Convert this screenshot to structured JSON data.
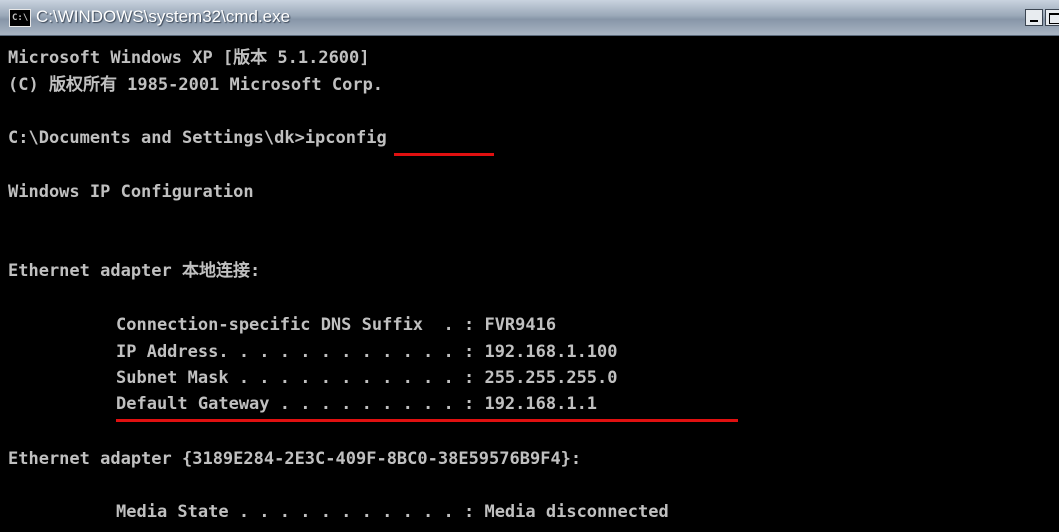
{
  "window": {
    "title": "C:\\WINDOWS\\system32\\cmd.exe",
    "icon_text": "C:\\"
  },
  "console": {
    "lines": {
      "version": "Microsoft Windows XP [版本 5.1.2600]",
      "copyright": "(C) 版权所有 1985-2001 Microsoft Corp.",
      "prompt_path": "C:\\Documents and Settings\\dk>",
      "prompt_command": "ipconfig",
      "header": "Windows IP Configuration",
      "eth1_header": "Ethernet adapter 本地连接:",
      "dns_suffix": "Connection-specific DNS Suffix  . : FVR9416",
      "ip_address": "IP Address. . . . . . . . . . . . : 192.168.1.100",
      "subnet_mask": "Subnet Mask . . . . . . . . . . . : 255.255.255.0",
      "default_gateway": "Default Gateway . . . . . . . . . : 192.168.1.1",
      "eth2_header": "Ethernet adapter {3189E284-2E3C-409F-8BC0-38E59576B9F4}:",
      "media_state": "Media State . . . . . . . . . . . : Media disconnected"
    }
  },
  "colors": {
    "console_bg": "#000000",
    "console_text": "#c0c0c0",
    "annotation_red": "#e01010"
  }
}
